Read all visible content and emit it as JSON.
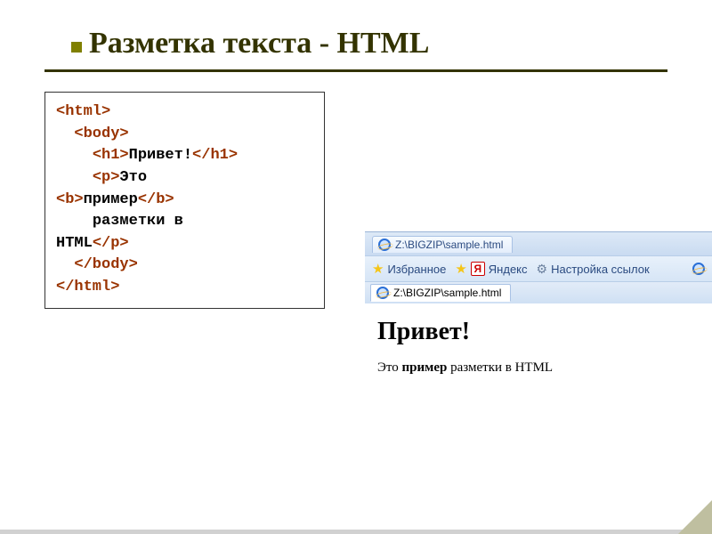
{
  "slide": {
    "title": "Разметка текста - HTML"
  },
  "code": {
    "l1_open": "<html>",
    "l2_open": "<body>",
    "l3_open": "<h1>",
    "l3_text": "Привет!",
    "l3_close": "</h1>",
    "l4_open": "<p>",
    "l4_text": "Это",
    "l5_open": "<b>",
    "l5_text": "пример",
    "l5_close": "</b>",
    "l6_text": "разметки в",
    "l7_text": "HTML",
    "l7_close": "</p>",
    "l8_close": "</body>",
    "l9_close": "</html>"
  },
  "browser": {
    "tab_title": "Z:\\BIGZIP\\sample.html",
    "favorites_label": "Избранное",
    "yandex_label": "Яндекс",
    "settings_label": "Настройка ссылок",
    "active_tab": "Z:\\BIGZIP\\sample.html",
    "y_glyph": "Я"
  },
  "page": {
    "h1": "Привет!",
    "p_before": "Это ",
    "p_bold": "пример",
    "p_after": " разметки в HTML"
  }
}
